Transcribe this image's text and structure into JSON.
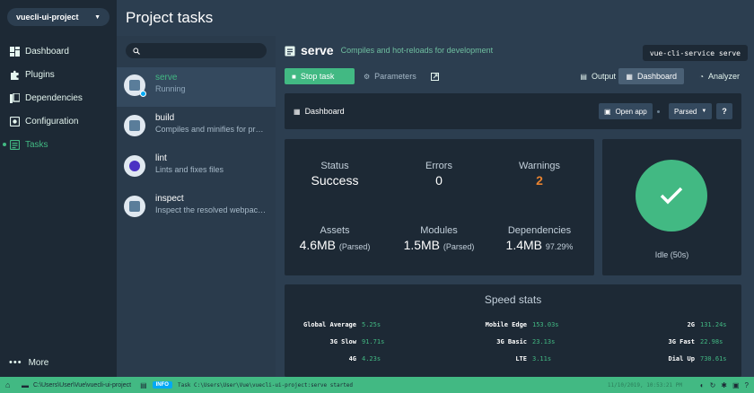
{
  "project": {
    "name": "vuecli-ui-project"
  },
  "nav": [
    {
      "label": "Dashboard",
      "icon": "dashboard-icon"
    },
    {
      "label": "Plugins",
      "icon": "puzzle-icon"
    },
    {
      "label": "Dependencies",
      "icon": "books-icon"
    },
    {
      "label": "Configuration",
      "icon": "gear-icon"
    },
    {
      "label": "Tasks",
      "icon": "tasks-icon",
      "active": true
    }
  ],
  "more_label": "More",
  "page_title": "Project tasks",
  "search": {
    "placeholder": ""
  },
  "tasks": [
    {
      "name": "serve",
      "desc": "Running",
      "selected": true
    },
    {
      "name": "build",
      "desc": "Compiles and minifies for production"
    },
    {
      "name": "lint",
      "desc": "Lints and fixes files"
    },
    {
      "name": "inspect",
      "desc": "Inspect the resolved webpack config"
    }
  ],
  "task_detail": {
    "name": "serve",
    "description": "Compiles and hot-reloads for development",
    "command": "vue-cli-service serve"
  },
  "toolbar": {
    "stop_label": "Stop task",
    "params_label": "Parameters",
    "output_label": "Output",
    "dashboard_label": "Dashboard",
    "analyzer_label": "Analyzer"
  },
  "dashboard": {
    "label": "Dashboard",
    "open_app_label": "Open app",
    "parsed_label": "Parsed",
    "help_label": "?"
  },
  "stats": {
    "status": {
      "label": "Status",
      "value": "Success"
    },
    "errors": {
      "label": "Errors",
      "value": "0"
    },
    "warnings": {
      "label": "Warnings",
      "value": "2"
    },
    "assets": {
      "label": "Assets",
      "value": "4.6MB",
      "note": "(Parsed)"
    },
    "modules": {
      "label": "Modules",
      "value": "1.5MB",
      "note": "(Parsed)"
    },
    "dependencies": {
      "label": "Dependencies",
      "value": "1.4MB",
      "note": "97.29%"
    }
  },
  "status_panel": {
    "idle": "Idle (50s)"
  },
  "speed": {
    "title": "Speed stats",
    "rows": [
      [
        {
          "k": "Global Average",
          "v": "5.25s"
        },
        {
          "k": "Mobile Edge",
          "v": "153.03s"
        },
        {
          "k": "2G",
          "v": "131.24s"
        }
      ],
      [
        {
          "k": "3G Slow",
          "v": "91.71s"
        },
        {
          "k": "3G Basic",
          "v": "23.13s"
        },
        {
          "k": "3G Fast",
          "v": "22.98s"
        }
      ],
      [
        {
          "k": "4G",
          "v": "4.23s"
        },
        {
          "k": "LTE",
          "v": "3.11s"
        },
        {
          "k": "Dial Up",
          "v": "730.61s"
        }
      ]
    ]
  },
  "statusbar": {
    "path": "C:\\Users\\User\\Vue\\vuecli-ui-project",
    "info_badge": "INFO",
    "log": "Task C:\\Users\\User\\Vue\\vuecli-ui-project:serve started",
    "time": "11/10/2019, 10:53:21 PM"
  },
  "colors": {
    "accent": "#42b983",
    "warning": "#e8822f",
    "sidebar": "#1d2935",
    "background": "#2c3e50"
  }
}
